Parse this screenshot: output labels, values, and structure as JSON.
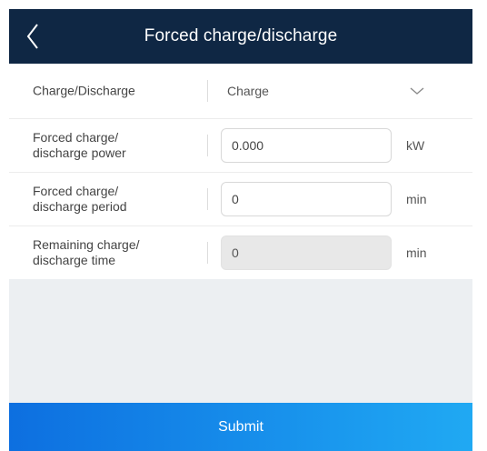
{
  "header": {
    "title": "Forced charge/discharge"
  },
  "form": {
    "mode": {
      "label": "Charge/Discharge",
      "value": "Charge"
    },
    "power": {
      "label_line1": "Forced charge/",
      "label_line2": "discharge power",
      "value": "0.000",
      "unit": "kW"
    },
    "period": {
      "label_line1": "Forced charge/",
      "label_line2": "discharge period",
      "value": "0",
      "unit": "min"
    },
    "remaining": {
      "label_line1": "Remaining charge/",
      "label_line2": "discharge time",
      "value": "0",
      "unit": "min"
    }
  },
  "footer": {
    "submit_label": "Submit"
  },
  "colors": {
    "header_bg": "#0f2744",
    "submit_start": "#0d6fe0",
    "submit_end": "#20a9f3",
    "empty_area": "#eceff2"
  },
  "icons": {
    "back": "chevron-left-icon",
    "dropdown": "chevron-down-icon"
  }
}
